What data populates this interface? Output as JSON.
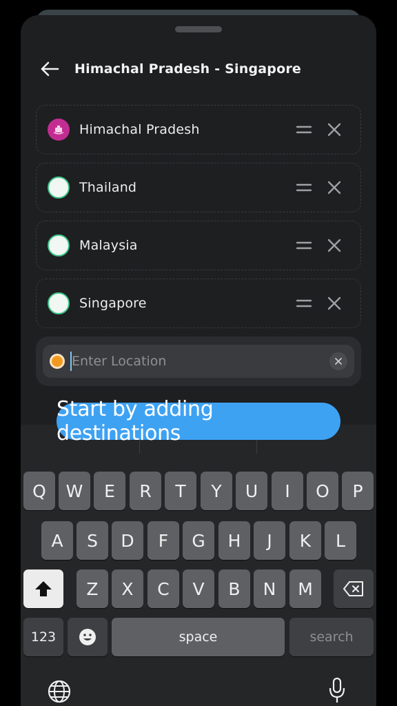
{
  "header": {
    "title": "Himachal Pradesh - Singapore",
    "back_icon": "arrow-left-icon"
  },
  "stops": [
    {
      "name": "Himachal Pradesh",
      "marker": "pink-start",
      "marker_color": "#c22d92"
    },
    {
      "name": "Thailand",
      "marker": "ring"
    },
    {
      "name": "Malaysia",
      "marker": "ring"
    },
    {
      "name": "Singapore",
      "marker": "ring"
    }
  ],
  "location_input": {
    "value": "",
    "placeholder": "Enter Location",
    "marker_color": "#f39a1e"
  },
  "tooltip": {
    "text": "Start by adding destinations",
    "color": "#3ea2f3"
  },
  "keyboard": {
    "row1": [
      "Q",
      "W",
      "E",
      "R",
      "T",
      "Y",
      "U",
      "I",
      "O",
      "P"
    ],
    "row2": [
      "A",
      "S",
      "D",
      "F",
      "G",
      "H",
      "J",
      "K",
      "L"
    ],
    "row3": [
      "Z",
      "X",
      "C",
      "V",
      "B",
      "N",
      "M"
    ],
    "numbers_key": "123",
    "space_key": "space",
    "return_key": "search"
  },
  "colors": {
    "sheet": "#1e1f21",
    "ring_accent": "#3fc48a",
    "key": "#5f6064"
  }
}
